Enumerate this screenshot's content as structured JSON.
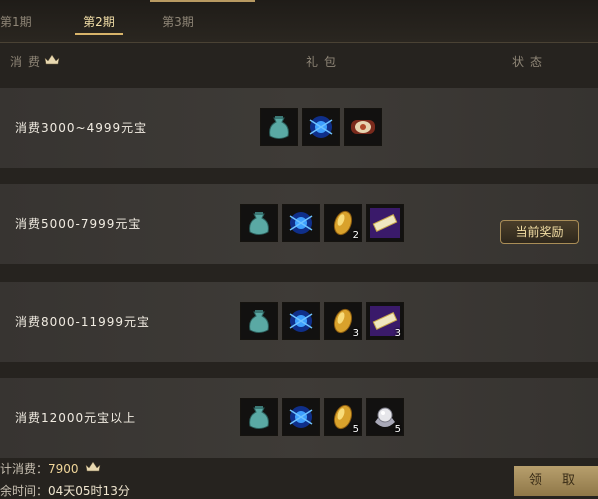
{
  "tabs": [
    "第1期",
    "第2期",
    "第3期"
  ],
  "header": {
    "consume": "消费",
    "gift": "礼包",
    "status": "状态"
  },
  "rows": [
    {
      "label": "消费3000~4999元宝",
      "items": [
        {
          "icon": "teal-pouch-icon",
          "count": ""
        },
        {
          "icon": "blue-gem-icon",
          "count": ""
        },
        {
          "icon": "scroll-icon",
          "count": ""
        }
      ]
    },
    {
      "label": "消费5000-7999元宝",
      "items": [
        {
          "icon": "teal-pouch-icon",
          "count": ""
        },
        {
          "icon": "blue-gem-icon",
          "count": ""
        },
        {
          "icon": "gold-ingot-icon",
          "count": "2"
        },
        {
          "icon": "silver-bar-icon",
          "count": ""
        }
      ]
    },
    {
      "label": "消费8000-11999元宝",
      "items": [
        {
          "icon": "teal-pouch-icon",
          "count": ""
        },
        {
          "icon": "blue-gem-icon",
          "count": ""
        },
        {
          "icon": "gold-ingot-icon",
          "count": "3"
        },
        {
          "icon": "silver-bar-icon",
          "count": "3"
        }
      ]
    },
    {
      "label": "消费12000元宝以上",
      "items": [
        {
          "icon": "teal-pouch-icon",
          "count": ""
        },
        {
          "icon": "blue-gem-icon",
          "count": ""
        },
        {
          "icon": "gold-ingot-icon",
          "count": "5"
        },
        {
          "icon": "pearl-icon",
          "count": "5"
        }
      ]
    }
  ],
  "status": {
    "current_reward": "当前奖励"
  },
  "footer": {
    "total_label": "计消费：",
    "total_value": "7900",
    "time_label": "余时间：",
    "time_value": "04天05时13分"
  },
  "claim_button": "领 取",
  "colors": {
    "accent_gold": "#d8b46a",
    "text_light": "#f1ece2",
    "panel": "#3e3b37"
  }
}
